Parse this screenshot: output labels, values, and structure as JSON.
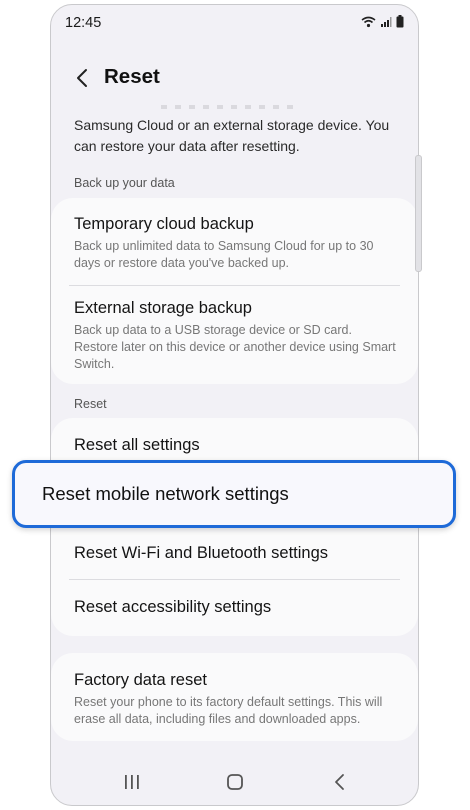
{
  "status_bar": {
    "time": "12:45"
  },
  "header": {
    "title": "Reset"
  },
  "intro_text": "Samsung Cloud or an external storage device. You can restore your data after resetting.",
  "backup_section": {
    "label": "Back up your data",
    "items": [
      {
        "title": "Temporary cloud backup",
        "subtitle": "Back up unlimited data to Samsung Cloud for up to 30 days or restore data you've backed up."
      },
      {
        "title": "External storage backup",
        "subtitle": "Back up data to a USB storage device or SD card. Restore later on this device or another device using Smart Switch."
      }
    ]
  },
  "reset_section": {
    "label": "Reset",
    "items": [
      {
        "title": "Reset all settings"
      },
      {
        "title": "Reset mobile network settings"
      },
      {
        "title": "Reset Wi-Fi and Bluetooth settings"
      },
      {
        "title": "Reset accessibility settings"
      }
    ]
  },
  "factory_reset": {
    "title": "Factory data reset",
    "subtitle": "Reset your phone to its factory default settings. This will erase all data, including files and downloaded apps."
  },
  "accent_color": "#1e6ad8"
}
